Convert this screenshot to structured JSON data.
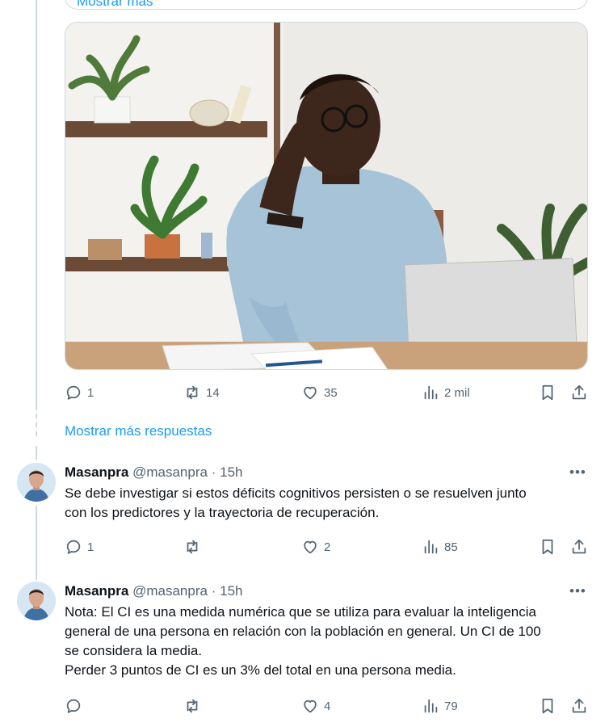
{
  "previous_card": {
    "show_more_label": "Mostrar más"
  },
  "main_tweet": {
    "stats": {
      "replies": "1",
      "retweets": "14",
      "likes": "35",
      "views": "2 mil"
    }
  },
  "show_more_replies": "Mostrar más respuestas",
  "replies": [
    {
      "name": "Masanpra",
      "handle": "@masanpra",
      "sep": "·",
      "time": "15h",
      "menu": "•••",
      "text_lines": [
        "Se debe investigar si estos déficits cognitivos persisten o se resuelven junto",
        "con los predictores y la trayectoria de recuperación."
      ],
      "stats": {
        "replies": "1",
        "retweets": "",
        "likes": "2",
        "views": "85"
      }
    },
    {
      "name": "Masanpra",
      "handle": "@masanpra",
      "sep": "·",
      "time": "15h",
      "menu": "•••",
      "text_lines": [
        "Nota: El CI es una medida numérica que se utiliza para evaluar la inteligencia",
        "general de una persona en relación con la población en general. Un CI de 100",
        "se considera la media.",
        "Perder 3 puntos de CI es un 3% del total en una persona media."
      ],
      "stats": {
        "replies": "",
        "retweets": "",
        "likes": "4",
        "views": "79"
      }
    }
  ],
  "icons": {
    "reply": "reply-icon",
    "retweet": "retweet-icon",
    "like": "heart-icon",
    "views": "views-icon",
    "bookmark": "bookmark-icon",
    "share": "share-icon"
  },
  "colors": {
    "accent": "#1d9bf0",
    "secondary_text": "#536471",
    "border": "#cfd9de",
    "text": "#0f1419"
  }
}
